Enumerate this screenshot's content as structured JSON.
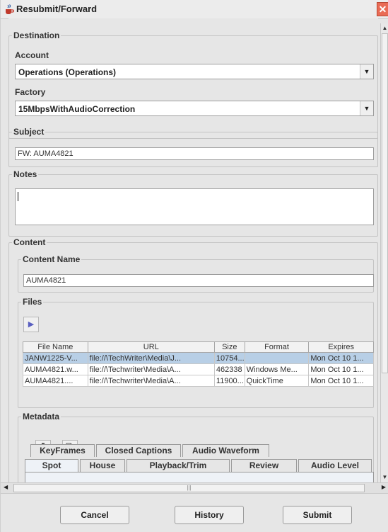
{
  "window": {
    "title": "Resubmit/Forward"
  },
  "destination": {
    "legend": "Destination",
    "account_label": "Account",
    "account_value": "Operations (Operations)",
    "factory_label": "Factory",
    "factory_value": "15MbpsWithAudioCorrection"
  },
  "subject": {
    "legend": "Subject",
    "value": "FW: AUMA4821"
  },
  "notes": {
    "legend": "Notes",
    "value": ""
  },
  "content": {
    "legend": "Content",
    "name_legend": "Content Name",
    "name_value": "AUMA4821",
    "files_legend": "Files",
    "files_table": {
      "columns": [
        "File Name",
        "URL",
        "Size",
        "Format",
        "Expires"
      ],
      "rows": [
        [
          "JANW1225-V...",
          "file://\\TechWriter\\Media\\J...",
          "10754...",
          "",
          "Mon Oct 10 1..."
        ],
        [
          "AUMA4821.w...",
          "file://\\Techwriter\\Media\\A...",
          "462338",
          "Windows Me...",
          "Mon Oct 10 1..."
        ],
        [
          "AUMA4821....",
          "file://\\Techwriter\\Media\\A...",
          "11900...",
          "QuickTime",
          "Mon Oct 10 1..."
        ]
      ],
      "selected_row": 0
    }
  },
  "metadata": {
    "legend": "Metadata",
    "tabs_row1": [
      "KeyFrames",
      "Closed Captions",
      "Audio Waveform"
    ],
    "tabs_row2": [
      "Spot",
      "House",
      "Playback/Trim",
      "Review",
      "Audio Level"
    ],
    "active_tab": "Spot"
  },
  "buttons": {
    "cancel": "Cancel",
    "history": "History",
    "submit": "Submit"
  },
  "icons": {
    "app": "java-cup-icon",
    "close": "close-icon",
    "play": "play-icon",
    "delete": "trash-icon",
    "add": "add-file-icon"
  }
}
